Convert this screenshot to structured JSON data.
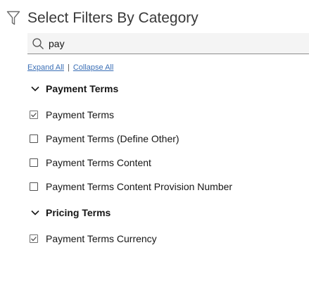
{
  "header": {
    "title": "Select Filters By Category",
    "icon": "filter-icon"
  },
  "search": {
    "value": "pay",
    "icon": "search-icon"
  },
  "links": {
    "expand_all": "Expand All",
    "separator": "|",
    "collapse_all": "Collapse All"
  },
  "groups": [
    {
      "label": "Payment Terms",
      "expanded": true,
      "options": [
        {
          "label": "Payment Terms",
          "checked": true
        },
        {
          "label": "Payment Terms (Define Other)",
          "checked": false
        },
        {
          "label": "Payment Terms Content",
          "checked": false
        },
        {
          "label": "Payment Terms Content Provision Number",
          "checked": false
        }
      ]
    },
    {
      "label": "Pricing Terms",
      "expanded": true,
      "options": [
        {
          "label": "Payment Terms Currency",
          "checked": true
        }
      ]
    }
  ],
  "colors": {
    "link": "#3b6fb6",
    "search_bg": "#f4f4f4",
    "title": "#393939"
  }
}
